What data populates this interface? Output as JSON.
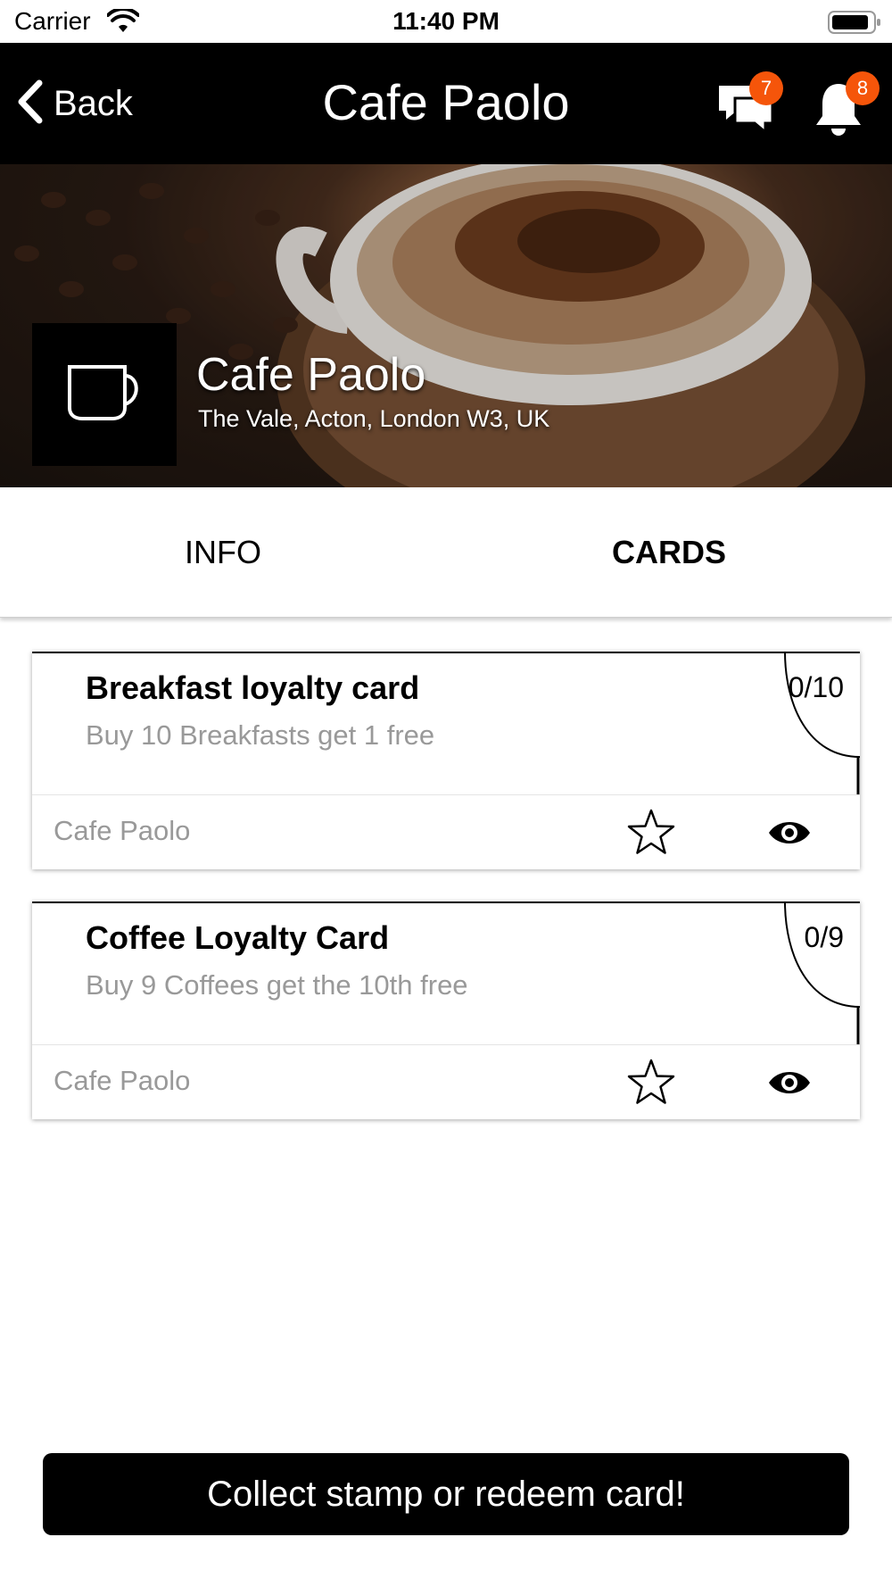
{
  "status_bar": {
    "carrier": "Carrier",
    "time": "11:40 PM"
  },
  "nav": {
    "back_label": "Back",
    "title": "Cafe Paolo",
    "messages_badge": "7",
    "notifications_badge": "8",
    "badge_color": "#f5550a"
  },
  "hero": {
    "shop_name": "Cafe Paolo",
    "address": "The Vale, Acton, London W3, UK"
  },
  "tabs": [
    {
      "label": "INFO",
      "active": false
    },
    {
      "label": "CARDS",
      "active": true
    }
  ],
  "cards": [
    {
      "title": "Breakfast loyalty card",
      "description": "Buy 10 Breakfasts get 1 free",
      "progress": "0/10",
      "shop": "Cafe Paolo"
    },
    {
      "title": "Coffee Loyalty Card",
      "description": "Buy 9 Coffees get the 10th free",
      "progress": "0/9",
      "shop": "Cafe Paolo"
    }
  ],
  "cta": {
    "label": "Collect stamp or redeem card!"
  }
}
